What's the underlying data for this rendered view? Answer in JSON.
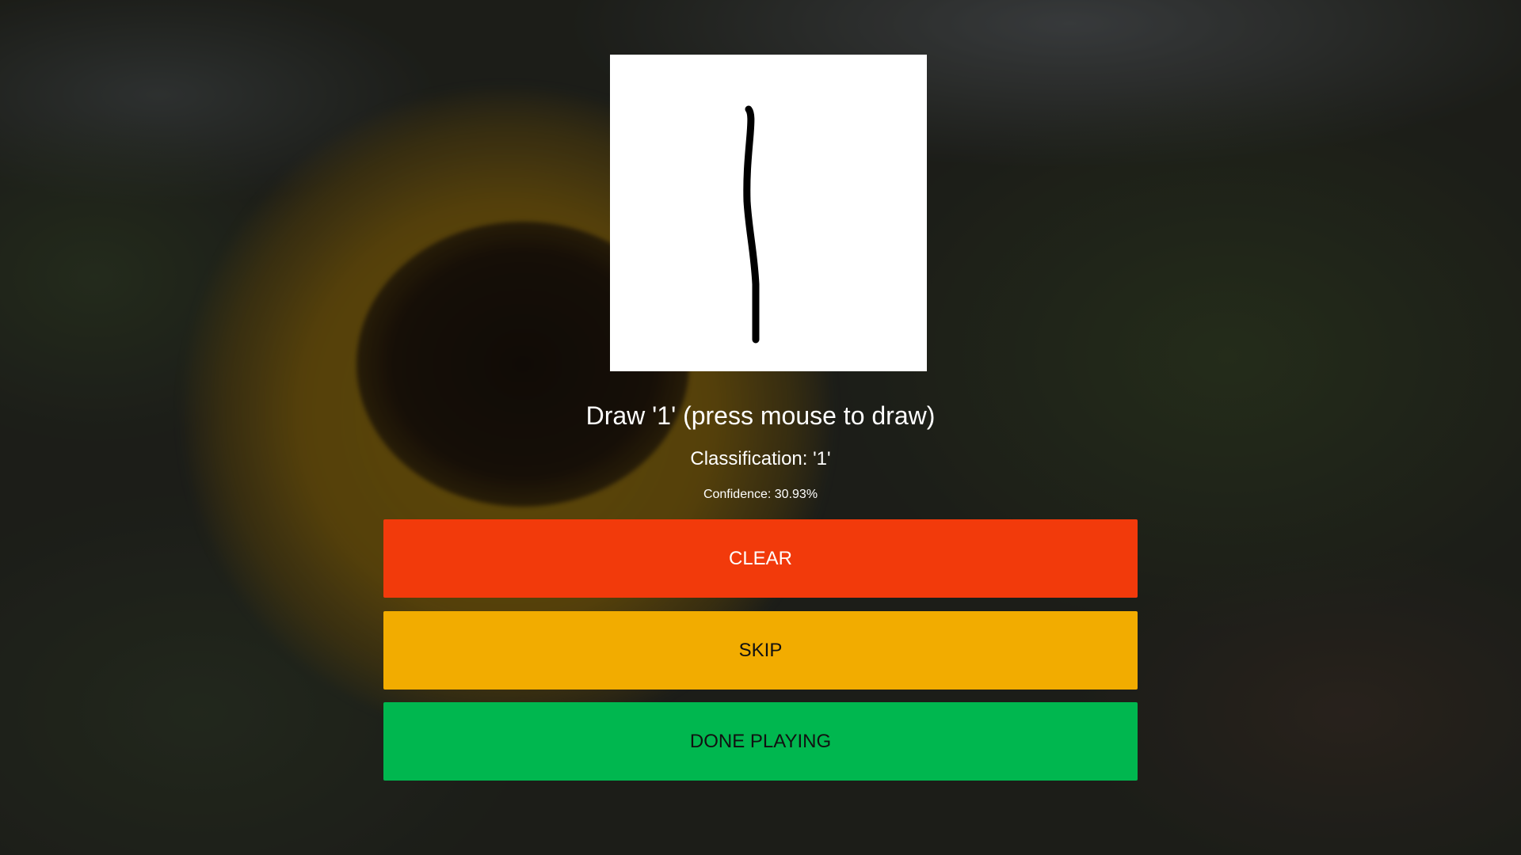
{
  "prompt_text": "Draw '1' (press mouse to draw)",
  "classification_text": "Classification: '1'",
  "confidence_text": "Confidence: 30.93%",
  "buttons": {
    "clear_label": "CLEAR",
    "skip_label": "SKIP",
    "done_label": "DONE PLAYING"
  },
  "colors": {
    "clear": "#F23A0B",
    "skip": "#F2AC00",
    "done": "#00B74F",
    "canvas": "#FFFFFF",
    "stroke": "#000000"
  },
  "icons": {
    "background": "sunflower-background-image",
    "drawing": "drawn-digit-stroke"
  }
}
